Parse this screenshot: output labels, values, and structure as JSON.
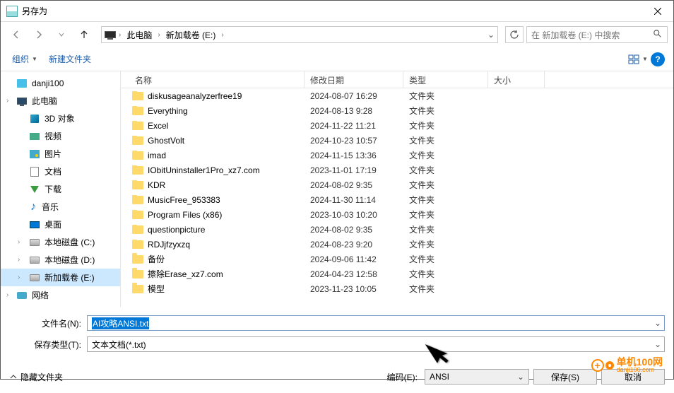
{
  "window": {
    "title": "另存为"
  },
  "breadcrumb": {
    "items": [
      "此电脑",
      "新加载卷 (E:)"
    ]
  },
  "search": {
    "placeholder": "在 新加载卷 (E:) 中搜索"
  },
  "toolbar": {
    "organize": "组织",
    "newfolder": "新建文件夹"
  },
  "sidebar": {
    "items": [
      {
        "label": "danji100",
        "icon": "box"
      },
      {
        "label": "此电脑",
        "icon": "pc",
        "expandable": true
      },
      {
        "label": "3D 对象",
        "icon": "3d",
        "sub": true
      },
      {
        "label": "视频",
        "icon": "vid",
        "sub": true
      },
      {
        "label": "图片",
        "icon": "pic",
        "sub": true
      },
      {
        "label": "文档",
        "icon": "doc",
        "sub": true
      },
      {
        "label": "下载",
        "icon": "dl",
        "sub": true
      },
      {
        "label": "音乐",
        "icon": "music",
        "sub": true
      },
      {
        "label": "桌面",
        "icon": "desk",
        "sub": true
      },
      {
        "label": "本地磁盘 (C:)",
        "icon": "disk",
        "sub": true,
        "expandable": true
      },
      {
        "label": "本地磁盘 (D:)",
        "icon": "disk",
        "sub": true,
        "expandable": true
      },
      {
        "label": "新加载卷 (E:)",
        "icon": "disk",
        "sub": true,
        "expandable": true,
        "selected": true
      },
      {
        "label": "网络",
        "icon": "net",
        "expandable": true
      }
    ]
  },
  "columns": {
    "name": "名称",
    "date": "修改日期",
    "type": "类型",
    "size": "大小"
  },
  "files": [
    {
      "name": "diskusageanalyzerfree19",
      "date": "2024-08-07 16:29",
      "type": "文件夹"
    },
    {
      "name": "Everything",
      "date": "2024-08-13 9:28",
      "type": "文件夹"
    },
    {
      "name": "Excel",
      "date": "2024-11-22 11:21",
      "type": "文件夹"
    },
    {
      "name": "GhostVolt",
      "date": "2024-10-23 10:57",
      "type": "文件夹"
    },
    {
      "name": "imad",
      "date": "2024-11-15 13:36",
      "type": "文件夹"
    },
    {
      "name": "IObitUninstaller1Pro_xz7.com",
      "date": "2023-11-01 17:19",
      "type": "文件夹"
    },
    {
      "name": "KDR",
      "date": "2024-08-02 9:35",
      "type": "文件夹"
    },
    {
      "name": "MusicFree_953383",
      "date": "2024-11-30 11:14",
      "type": "文件夹"
    },
    {
      "name": "Program Files (x86)",
      "date": "2023-10-03 10:20",
      "type": "文件夹"
    },
    {
      "name": "questionpicture",
      "date": "2024-08-02 9:35",
      "type": "文件夹"
    },
    {
      "name": "RDJjfzyxzq",
      "date": "2024-08-23 9:20",
      "type": "文件夹"
    },
    {
      "name": "备份",
      "date": "2024-09-06 11:42",
      "type": "文件夹"
    },
    {
      "name": "擦除Erase_xz7.com",
      "date": "2024-04-23 12:58",
      "type": "文件夹"
    },
    {
      "name": "模型",
      "date": "2023-11-23 10:05",
      "type": "文件夹"
    }
  ],
  "fields": {
    "filename_label": "文件名(N):",
    "filename_value": "AI攻略ANSI.txt",
    "type_label": "保存类型(T):",
    "type_value": "文本文档(*.txt)"
  },
  "footer": {
    "hide": "隐藏文件夹",
    "encoding_label": "编码(E):",
    "encoding_value": "ANSI",
    "save": "保存(S)",
    "cancel": "取消"
  },
  "watermark": {
    "t": "单机100网",
    "b": "danji100.com"
  }
}
